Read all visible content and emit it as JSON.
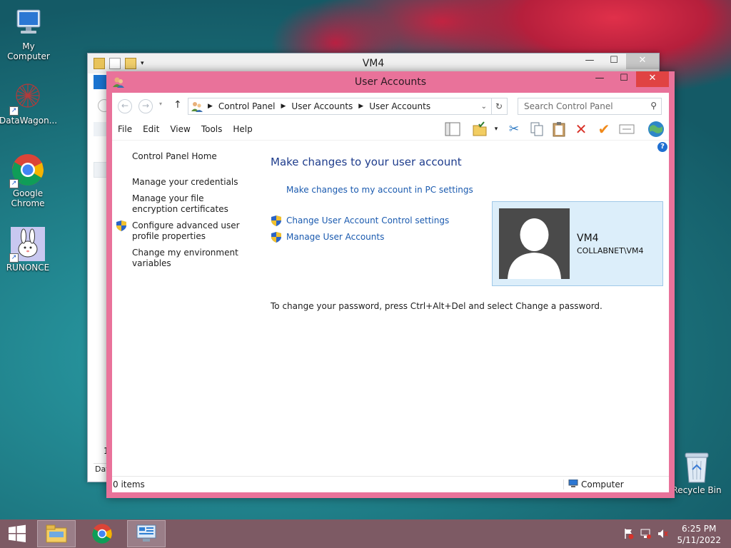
{
  "desktop": {
    "icons": [
      {
        "label": "My Computer"
      },
      {
        "label": "DataWagon..."
      },
      {
        "label": "Google Chrome"
      },
      {
        "label": "RUNONCE"
      },
      {
        "label": "Recycle Bin"
      }
    ]
  },
  "back_window": {
    "title": "VM4",
    "left_glyphs": [
      "1",
      "Dat"
    ]
  },
  "window": {
    "title": "User Accounts",
    "breadcrumb": [
      "Control Panel",
      "User Accounts",
      "User Accounts"
    ],
    "search_placeholder": "Search Control Panel",
    "menu": [
      "File",
      "Edit",
      "View",
      "Tools",
      "Help"
    ],
    "left_pane": {
      "home": "Control Panel Home",
      "links": [
        "Manage your credentials",
        "Manage your file encryption certificates",
        "Configure advanced user profile properties",
        "Change my environment variables"
      ]
    },
    "main": {
      "heading": "Make changes to your user account",
      "pc_settings_link": "Make changes to my account in PC settings",
      "uac_link": "Change User Account Control settings",
      "manage_link": "Manage User Accounts",
      "password_note": "To change your password, press Ctrl+Alt+Del and select Change a password."
    },
    "account": {
      "name": "VM4",
      "domain": "COLLABNET\\VM4"
    },
    "status": {
      "items": "0 items",
      "location": "Computer"
    }
  },
  "taskbar": {
    "time": "6:25 PM",
    "date": "5/11/2022"
  },
  "colors": {
    "window_frame": "#e9729a",
    "close_button": "#e04343",
    "link": "#1a5aaf",
    "heading": "#1e3c8c",
    "card_bg": "#dceefa",
    "taskbar": "#7d5a64"
  }
}
